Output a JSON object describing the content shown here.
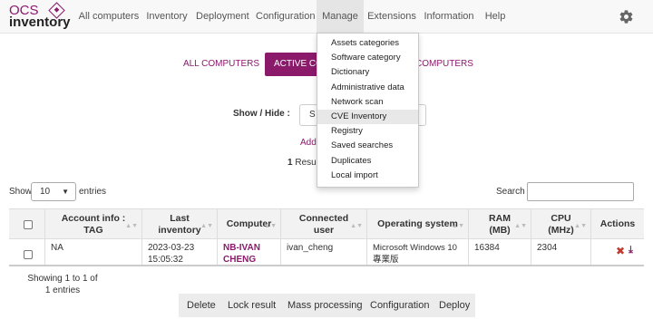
{
  "logo": {
    "line1": "OCS",
    "line2": "inventory"
  },
  "nav": {
    "items": [
      "All computers",
      "Inventory",
      "Deployment",
      "Configuration",
      "Manage",
      "Extensions",
      "Information",
      "Help"
    ],
    "active": "Manage",
    "settings_icon": "gear-icon"
  },
  "tabs": [
    "ALL COMPUTERS",
    "ACTIVE COMPUTERS",
    "ARCHIVED COMPUTERS"
  ],
  "tabs_visible": [
    "ALL COMPUTERS",
    "ACTIVE CO",
    "COMPUTERS"
  ],
  "show_hide": {
    "label": "Show / Hide :",
    "value": "S"
  },
  "add_link": "Add c",
  "results": {
    "count": "1",
    "text": " Result("
  },
  "dropdown": {
    "items": [
      "Assets categories",
      "Software category",
      "Dictionary",
      "Administrative data",
      "Network scan",
      "CVE Inventory",
      "Registry",
      "Saved searches",
      "Duplicates",
      "Local import"
    ],
    "highlighted": "CVE Inventory"
  },
  "length": {
    "show": "Show",
    "value": "10",
    "entries": "entries"
  },
  "search": {
    "label": "Search :",
    "value": ""
  },
  "table": {
    "headers": [
      "",
      "Account info : TAG",
      "Last inventory",
      "Computer",
      "Connected user",
      "Operating system",
      "RAM (MB)",
      "CPU (MHz)",
      "Actions"
    ],
    "rows": [
      {
        "tag": "NA",
        "last_inventory": "2023-03-23 15:05:32",
        "computer": "NB-IVANCHENG",
        "user": "ivan_cheng",
        "os": "Microsoft Windows 10 專業版",
        "ram": "16384",
        "cpu": "2304"
      }
    ]
  },
  "info": "Showing 1 to 1 of 1 entries",
  "buttons": [
    "Delete",
    "Lock result",
    "Mass processing",
    "Configuration",
    "Deploy"
  ],
  "colors": {
    "brand": "#8b1a6b",
    "delete": "#c0392b"
  }
}
